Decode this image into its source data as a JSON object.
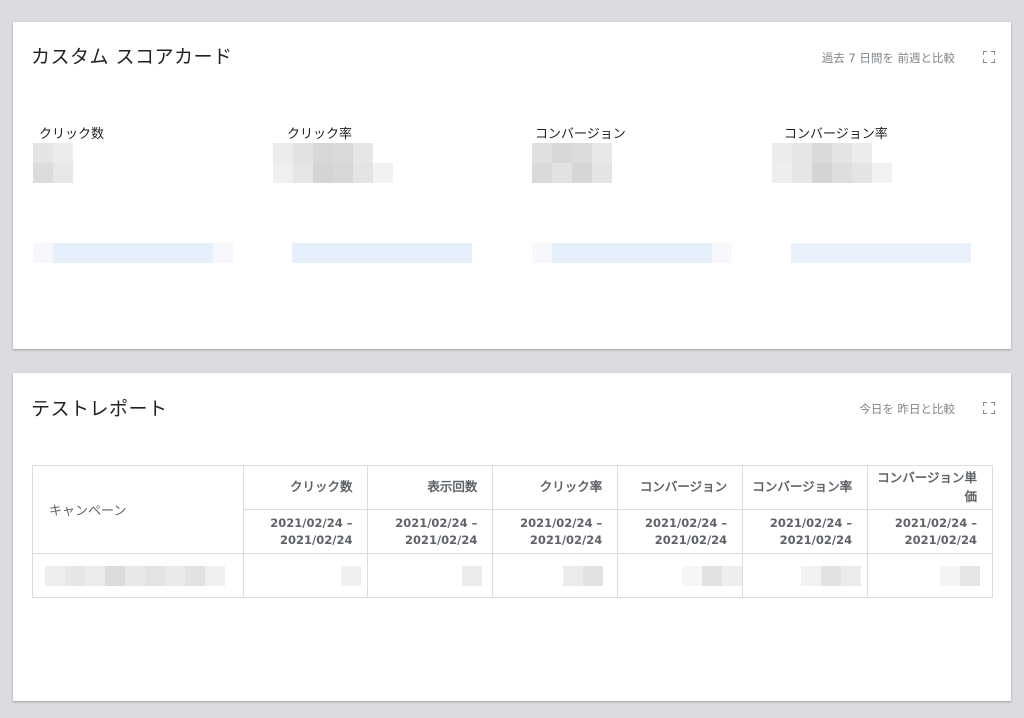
{
  "scorecard": {
    "title": "カスタム スコアカード",
    "compare": "過去 7 日間を 前週と比較",
    "metrics": [
      {
        "label": "クリック数"
      },
      {
        "label": "クリック率"
      },
      {
        "label": "コンバージョン"
      },
      {
        "label": "コンバージョン率"
      }
    ]
  },
  "report": {
    "title": "テストレポート",
    "compare": "今日を 昨日と比較",
    "campaign_header": "キャンペーン",
    "columns": [
      {
        "label": "クリック数",
        "range_start": "2021/02/24 –",
        "range_end": "2021/02/24"
      },
      {
        "label": "表示回数",
        "range_start": "2021/02/24 –",
        "range_end": "2021/02/24"
      },
      {
        "label": "クリック率",
        "range_start": "2021/02/24 –",
        "range_end": "2021/02/24"
      },
      {
        "label": "コンバージョン",
        "range_start": "2021/02/24 –",
        "range_end": "2021/02/24"
      },
      {
        "label": "コンバージョン率",
        "range_start": "2021/02/24 –",
        "range_end": "2021/02/24"
      },
      {
        "label": "コンバージョン単価",
        "range_start": "2021/02/24 –",
        "range_end": "2021/02/24"
      }
    ]
  },
  "colors": {
    "page_bg": "#dadce0",
    "card_bg": "#ffffff",
    "muted_text": "#80868b",
    "sparkline_fill": "#e6effc"
  },
  "icons": {
    "expand": "fullscreen-expand-icon"
  }
}
